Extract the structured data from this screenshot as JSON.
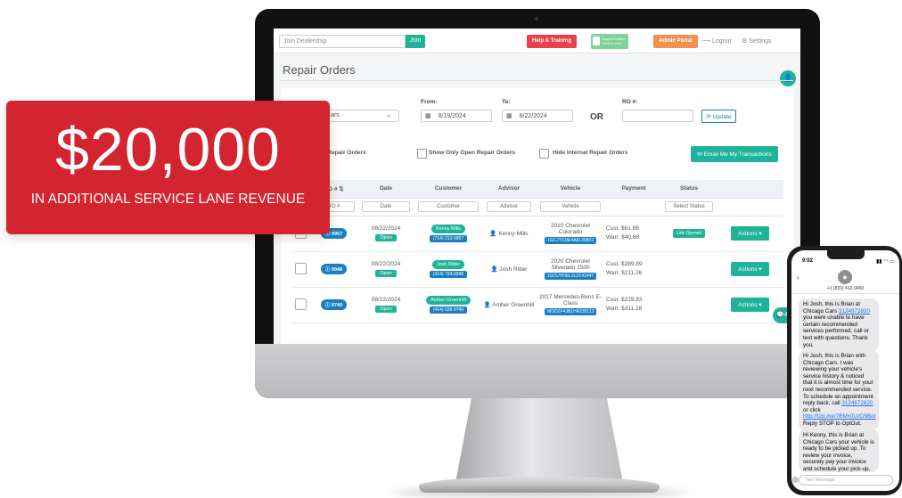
{
  "topbar": {
    "dealer_placeholder": "Join Dealership",
    "join": "Join",
    "help": "Help & Training",
    "support_line1": "Support Online",
    "support_line2": "Click to chat",
    "admin": "Admin Portal",
    "logout": "⟶ Logout",
    "settings": "⚙ Settings"
  },
  "page": {
    "title": "Repair Orders"
  },
  "filters": {
    "store_value": "Cars",
    "from_label": "From:",
    "from_value": "8/19/2024",
    "to_label": "To:",
    "to_value": "8/22/2024",
    "or": "OR",
    "ro_label": "RO #:",
    "update": "Update",
    "my_orders": "y My Repair Orders",
    "only_open": "Show Only Open Repair Orders",
    "hide_internal": "Hide Internal Repair Orders",
    "email_btn": "Email Me My Transactions"
  },
  "table": {
    "headers": [
      "RO #",
      "Date",
      "Customer",
      "Advisor",
      "Vehicle",
      "Payment",
      "Status"
    ],
    "filter_placeholders": [
      "RO #",
      "Date",
      "Customer",
      "Advisor",
      "Vehicle",
      "",
      "Select Status"
    ],
    "rows": [
      {
        "ro": "9957",
        "date": "08/22/2024",
        "status_pill": "Open",
        "customer": "Kenny Mills",
        "phone": "(714) 213-9957",
        "advisor": "Kenny Mills",
        "vehicle_line1": "2010 Chevrolet",
        "vehicle_line2": "Colorado",
        "vin": "1GCJTCDE4A8136802",
        "cust_amt": "Cust.  $61.88",
        "warr_amt": "Warr.  $40.68",
        "status": "Link Opened",
        "actions": "Actions ▾"
      },
      {
        "ro": "9948",
        "date": "08/22/2024",
        "status_pill": "Open",
        "customer": "Josh Ritter",
        "phone": "(414) 704-9948",
        "advisor": "Josh Ritter",
        "vehicle_line1": "2020 Chevrolet",
        "vehicle_line2": "Silverado 1500",
        "vin": "1GCUYHEL3LZ141447",
        "cust_amt": "Cust.  $289.89",
        "warr_amt": "Warr.  $211.26",
        "status": "",
        "actions": "Actions ▾"
      },
      {
        "ro": "9740",
        "date": "08/22/2024",
        "status_pill": "Open",
        "customer": "Amber Greenhill",
        "phone": "(414) 939-9740",
        "advisor": "Amber Greenhill",
        "vehicle_line1": "2017 Mercedes-Benz E-",
        "vehicle_line2": "Class",
        "vin": "WDDZF4JB1HA235113",
        "cust_amt": "Cust.  $219.83",
        "warr_amt": "Warr.  $311.28",
        "status": "",
        "actions": "Actions ▾"
      }
    ]
  },
  "chat_badge": "4",
  "banner": {
    "amount": "$20,000",
    "subtitle": "IN ADDITIONAL SERVICE LANE REVENUE"
  },
  "phone": {
    "time": "9:02",
    "number": "+1 (833) 412-0450",
    "message_placeholder": "Text Message",
    "msg1_a": "Hi Josh, this is Brian at Chicago Cars ",
    "msg1_link": "3124872820",
    "msg1_b": " you were unable to have certain recommended services performed, call or text with questions. Thank you.",
    "msg2_a": "Hi Josh, this is Brian with Chicago Cars. I was reviewing your vehicle's service history & noticed that it is almost time for your next recommended service. To schedule an appointment reply back, call ",
    "msg2_link1": "3124872820",
    "msg2_b": " or click ",
    "msg2_link2": "http://t2d.me/7BMx0UzD9Bor",
    "msg2_c": " Reply STOP to OptOut.",
    "msg3": "Hi Kenny, this is Brian at Chicago Cars your vehicle is ready to be picked up. To review your invoice, securely pay your invoice and schedule your pick-up, click"
  }
}
